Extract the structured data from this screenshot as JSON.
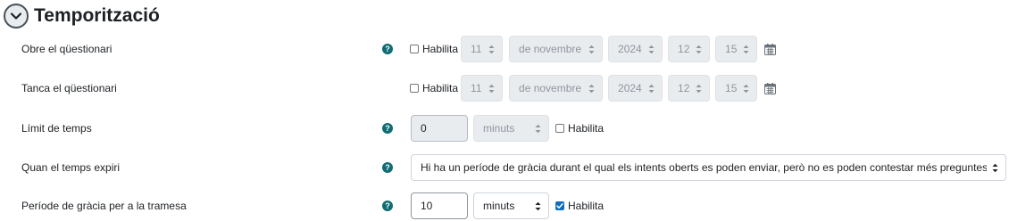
{
  "section": {
    "title": "Temporització"
  },
  "rows": {
    "open": {
      "label": "Obre el qüestionari",
      "enable_label": "Habilita",
      "day": "11",
      "month": "de novembre",
      "year": "2024",
      "hour": "12",
      "minute": "15"
    },
    "close": {
      "label": "Tanca el qüestionari",
      "enable_label": "Habilita",
      "day": "11",
      "month": "de novembre",
      "year": "2024",
      "hour": "12",
      "minute": "15"
    },
    "time_limit": {
      "label": "Límit de temps",
      "value": "0",
      "unit": "minuts",
      "enable_label": "Habilita"
    },
    "expiry": {
      "label": "Quan el temps expiri",
      "value": "Hi ha un període de gràcia durant el qual els intents oberts es poden enviar, però no es poden contestar més preguntes"
    },
    "grace": {
      "label": "Període de gràcia per a la tramesa",
      "value": "10",
      "unit": "minuts",
      "enable_label": "Habilita"
    }
  },
  "colors": {
    "help": "#0f6c73",
    "checked": "#0f6cbf"
  },
  "icons": [
    "chevron-down-icon",
    "help-icon",
    "calendar-icon",
    "select-arrows-icon",
    "checkmark-icon"
  ]
}
